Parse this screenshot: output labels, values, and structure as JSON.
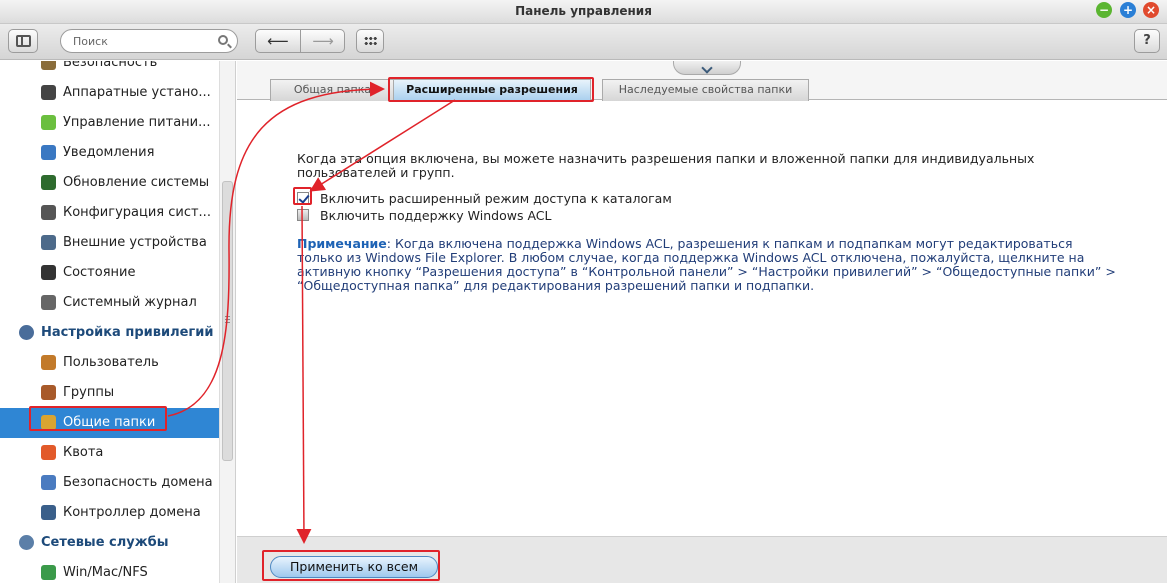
{
  "window": {
    "title": "Панель управления"
  },
  "toolbar": {
    "search_placeholder": "Поиск",
    "back": "⟵",
    "forward": "⟶",
    "help": "?"
  },
  "sidebar": {
    "items": [
      {
        "label": "Безопасность",
        "icon": "lock-icon",
        "type": "item"
      },
      {
        "label": "Аппаратные устано...",
        "icon": "hardware-icon",
        "type": "item"
      },
      {
        "label": "Управление питани...",
        "icon": "power-icon",
        "type": "item"
      },
      {
        "label": "Уведомления",
        "icon": "notification-icon",
        "type": "item"
      },
      {
        "label": "Обновление системы",
        "icon": "update-icon",
        "type": "item"
      },
      {
        "label": "Конфигурация сист...",
        "icon": "gear-icon",
        "type": "item"
      },
      {
        "label": "Внешние устройства",
        "icon": "external-device-icon",
        "type": "item"
      },
      {
        "label": "Состояние",
        "icon": "monitor-icon",
        "type": "item"
      },
      {
        "label": "Системный журнал",
        "icon": "log-icon",
        "type": "item"
      },
      {
        "label": "Настройка привилегий",
        "icon": "privilege-icon",
        "type": "head"
      },
      {
        "label": "Пользователь",
        "icon": "user-icon",
        "type": "item"
      },
      {
        "label": "Группы",
        "icon": "group-icon",
        "type": "item"
      },
      {
        "label": "Общие папки",
        "icon": "shared-folder-icon",
        "type": "item",
        "active": true
      },
      {
        "label": "Квота",
        "icon": "quota-icon",
        "type": "item"
      },
      {
        "label": "Безопасность домена",
        "icon": "domain-security-icon",
        "type": "item"
      },
      {
        "label": "Контроллер домена",
        "icon": "domain-controller-icon",
        "type": "item"
      },
      {
        "label": "Сетевые службы",
        "icon": "network-services-icon",
        "type": "head"
      },
      {
        "label": "Win/Mac/NFS",
        "icon": "winmacnfs-icon",
        "type": "item"
      }
    ]
  },
  "tabs": [
    {
      "label": "Общая папка"
    },
    {
      "label": "Расширенные разрешения",
      "active": true
    },
    {
      "label": "Наследуемые свойства папки"
    }
  ],
  "content": {
    "description": "Когда эта опция включена, вы можете назначить разрешения папки и вложенной папки для индивидуальных пользователей и групп.",
    "options": [
      {
        "label": "Включить расширенный режим доступа к каталогам",
        "checked": true
      },
      {
        "label": "Включить поддержку Windows ACL",
        "checked": false
      }
    ],
    "note_label": "Примечание",
    "note_text": ": Когда включена поддержка Windows ACL, разрешения к папкам и подпапкам могут редактироваться только из Windows File Explorer. В любом случае, когда поддержка Windows ACL отключена, пожалуйста, щелкните на активную кнопку “Разрешения доступа” в “Контрольной панели” > “Настройки привилегий” > “Общедоступные папки” > “Общедоступная папка” для редактирования разрешений папки и подпапки."
  },
  "footer": {
    "apply_label": "Применить ко всем"
  },
  "colors": {
    "accent": "#2f86d4",
    "annotation": "#e0232a",
    "heading": "#1d4a7a"
  }
}
